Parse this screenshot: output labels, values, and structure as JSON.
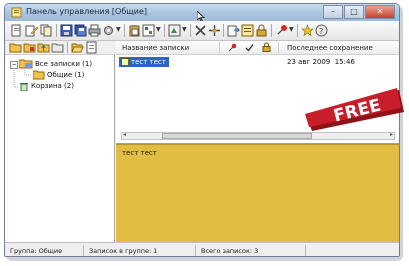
{
  "window": {
    "title": "Панель управления [Общие]"
  },
  "tree": {
    "items": [
      {
        "label": "Все записки (1)"
      },
      {
        "label": "Общие (1)"
      },
      {
        "label": "Корзина (2)"
      }
    ]
  },
  "list": {
    "columns": {
      "name": "Название записки",
      "last_saved": "Последнее сохранение"
    },
    "rows": [
      {
        "name": "тест тест",
        "date": "23 авг 2009",
        "time": "15:46"
      }
    ]
  },
  "preview": {
    "text": "тест тест"
  },
  "status": {
    "group": "Группа: Общие",
    "notes_in_group": "Записок в группе: 1",
    "total": "Всего записок: 3"
  },
  "badge": {
    "text": "FREE",
    "color": "#c81e2a"
  },
  "icons": [
    "app-icon",
    "cursor-icon",
    "minimize-icon",
    "maximize-icon",
    "close-icon",
    "toolbar-icons",
    "folder-icon",
    "trash-icon",
    "note-icon",
    "flag-icon",
    "check-icon",
    "lock-icon"
  ]
}
